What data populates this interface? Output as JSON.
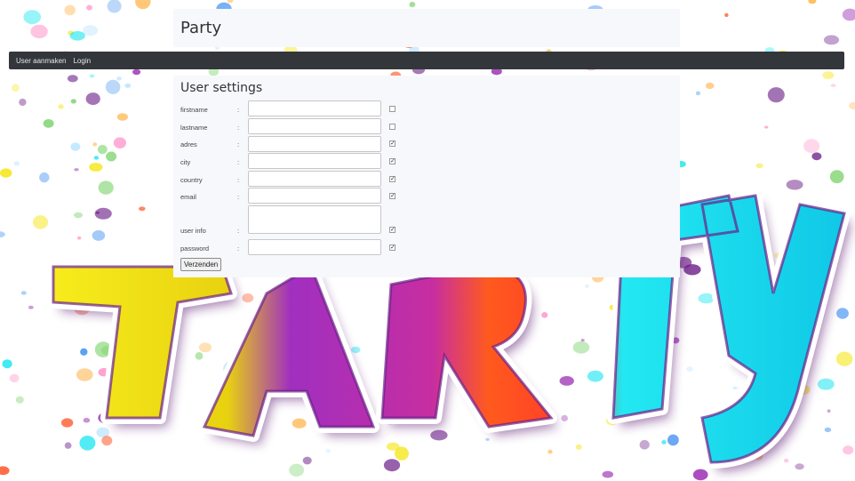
{
  "site": {
    "title": "Party"
  },
  "nav": {
    "items": [
      {
        "label": "User aanmaken"
      },
      {
        "label": "Login"
      }
    ]
  },
  "form": {
    "title": "User settings",
    "colon": ":",
    "fields": [
      {
        "label": "firstname",
        "value": "",
        "checked": false
      },
      {
        "label": "lastname",
        "value": "",
        "checked": false
      },
      {
        "label": "adres",
        "value": "",
        "checked": true
      },
      {
        "label": "city",
        "value": "",
        "checked": true
      },
      {
        "label": "country",
        "value": "",
        "checked": true
      },
      {
        "label": "email",
        "value": "",
        "checked": true
      },
      {
        "label": "user info",
        "value": "",
        "checked": true
      },
      {
        "label": "password",
        "value": "",
        "checked": true
      }
    ],
    "submit_label": "Verzenden"
  },
  "background": {
    "artwork_text": "PARTY",
    "colors": [
      "#f5e614",
      "#9b2bb3",
      "#ff4e1f",
      "#18e6f0",
      "#6b1e87"
    ]
  }
}
